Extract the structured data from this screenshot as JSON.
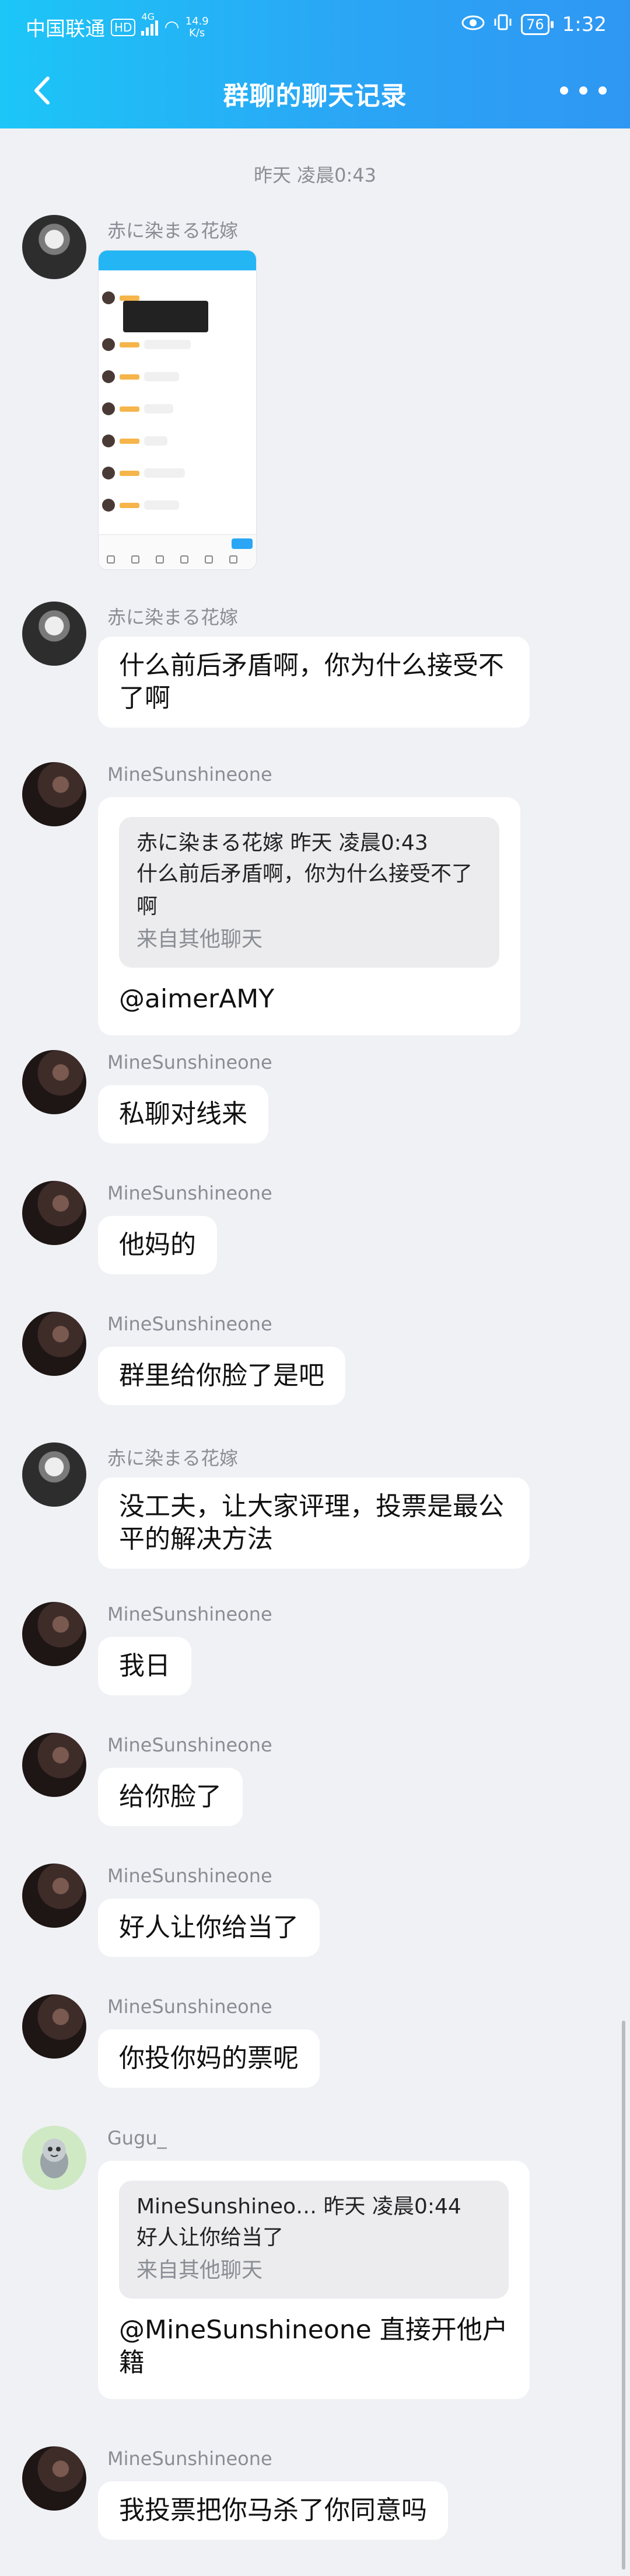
{
  "status": {
    "carrier": "中国联通",
    "hd": "HD",
    "net_gen": "4G",
    "speed_value": "14.9",
    "speed_unit": "K/s",
    "battery": "76",
    "time": "1:32"
  },
  "header": {
    "title": "群聊的聊天记录"
  },
  "time_separator": "昨天 凌晨0:43",
  "messages": [
    {
      "sender": "赤に染まる花嫁",
      "type": "image"
    },
    {
      "sender": "赤に染まる花嫁",
      "text": "什么前后矛盾啊，你为什么接受不了啊"
    },
    {
      "sender": "MineSunshineone",
      "quote": {
        "head": "赤に染まる花嫁 昨天 凌晨0:43",
        "text": "什么前后矛盾啊，你为什么接受不了啊",
        "foot": "来自其他聊天"
      },
      "text": "@aimerAMY"
    },
    {
      "sender": "MineSunshineone",
      "text": "私聊对线来"
    },
    {
      "sender": "MineSunshineone",
      "text": "他妈的"
    },
    {
      "sender": "MineSunshineone",
      "text": "群里给你脸了是吧"
    },
    {
      "sender": "赤に染まる花嫁",
      "text": "没工夫，让大家评理，投票是最公平的解决方法"
    },
    {
      "sender": "MineSunshineone",
      "text": "我日"
    },
    {
      "sender": "MineSunshineone",
      "text": "给你脸了"
    },
    {
      "sender": "MineSunshineone",
      "text": "好人让你给当了"
    },
    {
      "sender": "MineSunshineone",
      "text": "你投你妈的票呢"
    },
    {
      "sender": "Gugu_",
      "quote": {
        "head": "MineSunshineo… 昨天 凌晨0:44",
        "text": "好人让你给当了",
        "foot": "来自其他聊天"
      },
      "text": "@MineSunshineone 直接开他户籍"
    },
    {
      "sender": "MineSunshineone",
      "text": "我投票把你马杀了你同意吗"
    }
  ],
  "colors": {
    "header_start": "#1cc6f7",
    "header_end": "#2f97f3",
    "background": "#f0f1f5",
    "bubble": "#ffffff"
  }
}
